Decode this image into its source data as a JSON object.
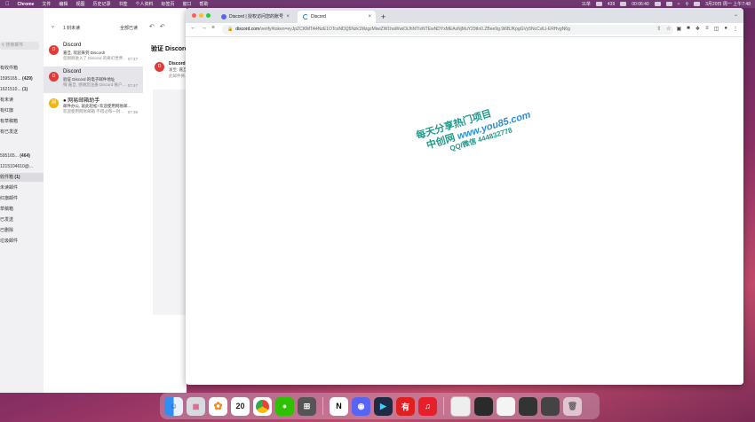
{
  "menubar": {
    "app": "Chrome",
    "items": [
      "文件",
      "编辑",
      "视图",
      "历史记录",
      "书签",
      "个人资料",
      "标签页",
      "窗口",
      "帮助"
    ],
    "status": [
      "11单",
      "439",
      "00:06:40"
    ],
    "clock": "3月20日 周一 上午7:48"
  },
  "mail": {
    "search_placeholder": "搜索邮件",
    "sidebar": [
      {
        "label": "有收件箱",
        "count": ""
      },
      {
        "label": "1595165...",
        "count": "(429)"
      },
      {
        "label": "1621510...",
        "count": "(1)"
      },
      {
        "label": "有未读",
        "count": ""
      },
      {
        "label": "有红旗",
        "count": ""
      },
      {
        "label": "有草稿箱",
        "count": ""
      },
      {
        "label": "有已发送",
        "count": ""
      },
      {
        "label": "595165...",
        "count": "(464)"
      },
      {
        "label": "1215104610@...",
        "count": ""
      },
      {
        "label": "收件箱",
        "count": "(1)"
      },
      {
        "label": "未读邮件",
        "count": ""
      },
      {
        "label": "红旗邮件",
        "count": ""
      },
      {
        "label": "草稿箱",
        "count": ""
      },
      {
        "label": "已发送",
        "count": ""
      },
      {
        "label": "已删除",
        "count": ""
      },
      {
        "label": "垃圾邮件",
        "count": ""
      }
    ],
    "list_count": "1 封未读",
    "read_all": "全部已读",
    "messages": [
      {
        "initial": "D",
        "sender": "Discord",
        "subject": "嘉旦, 欢迎来到 Discord!",
        "preview": "您刚刚进入了 Discord 的奇幻世界...",
        "time": "07:47",
        "color": "#e53935"
      },
      {
        "initial": "D",
        "sender": "Discord",
        "subject": "验证 Discord 的电子邮件地址",
        "preview": "嗨 嘉旦, 感谢您注册 Discord 账户...",
        "time": "07:47",
        "color": "#e53935"
      },
      {
        "initial": "网",
        "sender": "● 网易邮箱助手",
        "subject": "邮件办公, 就此轻松! 欢迎使用网易邮...",
        "preview": "欢迎使用网易邮箱 不错过每一封...",
        "time": "07:36",
        "color": "#f5b400"
      }
    ],
    "reader": {
      "title": "验证 Discord",
      "sender": "Discord",
      "to": "发至: 嘉旦",
      "preview": "此邮件将..."
    }
  },
  "browser": {
    "tabs": [
      {
        "title": "Discord | 授权访问您的账号",
        "active": false
      },
      {
        "title": "Discord",
        "active": true
      }
    ],
    "url_host": "discord.com",
    "url_path": "/verify#token=eyJpZCI6MTA4NzE1OTcxNDQ5Nzk1MzgzMiwiZW1haWwiOiJhNTIxNTEwNDYxMEAxNjMuY29tIn0.ZBee9g.9i6BJKpgGVy5NcCvlLl-ERHvgN6g"
  },
  "watermark": {
    "line1": "每天分享热门项目",
    "line2_prefix": "中创网 ",
    "line2_url": "www.you85.com",
    "line3": "QQ/微信 444832778"
  },
  "dock": {
    "date_day": "20",
    "apps": [
      "finder-icon",
      "launchpad-icon",
      "photos-icon",
      "calendar-icon",
      "chrome-icon",
      "wechat-icon",
      "calculator-icon",
      "notion-icon",
      "discord-icon",
      "video-icon",
      "youdao-icon",
      "netease-music-icon"
    ]
  }
}
